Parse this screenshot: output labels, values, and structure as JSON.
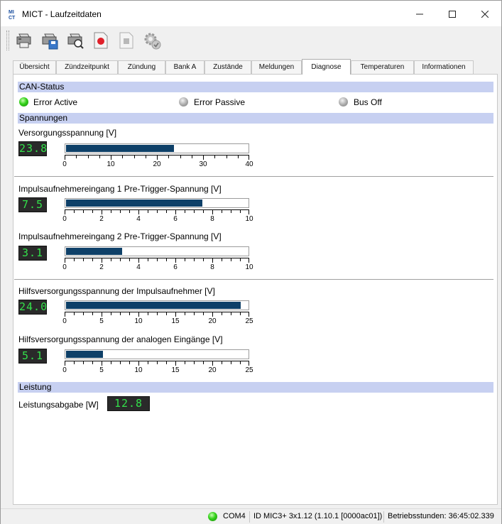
{
  "window": {
    "title": "MICT - Laufzeitdaten"
  },
  "toolbar": {
    "buttons": [
      "printer-icon",
      "save-printer-icon",
      "search-printer-icon",
      "record-icon",
      "stop-icon",
      "settings-check-icon"
    ]
  },
  "tabs": [
    "Übersicht",
    "Zündzeitpunkt",
    "Zündung",
    "Bank A",
    "Zustände",
    "Meldungen",
    "Diagnose",
    "Temperaturen",
    "Informationen"
  ],
  "active_tab": "Diagnose",
  "can_status": {
    "header": "CAN-Status",
    "items": [
      {
        "label": "Error Active",
        "state": "green"
      },
      {
        "label": "Error Passive",
        "state": "grey"
      },
      {
        "label": "Bus Off",
        "state": "grey"
      }
    ]
  },
  "spannungen": {
    "header": "Spannungen",
    "gauges": [
      {
        "label": "Versorgungsspannung [V]",
        "display": "23.8",
        "value": 23.8,
        "max": 40,
        "ticks": [
          "0",
          "10",
          "20",
          "30",
          "40"
        ]
      },
      {
        "label": "Impulsaufnehmereingang 1 Pre-Trigger-Spannung [V]",
        "display": "7.5",
        "value": 7.5,
        "max": 10,
        "ticks": [
          "0",
          "2",
          "4",
          "6",
          "8",
          "10"
        ]
      },
      {
        "label": "Impulsaufnehmereingang 2 Pre-Trigger-Spannung [V]",
        "display": "3.1",
        "value": 3.1,
        "max": 10,
        "ticks": [
          "0",
          "2",
          "4",
          "6",
          "8",
          "10"
        ]
      },
      {
        "label": "Hilfsversorgungsspannung der Impulsaufnehmer [V]",
        "display": "24.0",
        "value": 24.0,
        "max": 25,
        "ticks": [
          "0",
          "5",
          "10",
          "15",
          "20",
          "25"
        ]
      },
      {
        "label": "Hilfsversorgungsspannung der analogen Eingänge [V]",
        "display": "5.1",
        "value": 5.1,
        "max": 25,
        "ticks": [
          "0",
          "5",
          "10",
          "15",
          "20",
          "25"
        ]
      }
    ]
  },
  "leistung": {
    "header": "Leistung",
    "label": "Leistungsabgabe [W]",
    "display": "12.8"
  },
  "statusbar": {
    "port": "COM4",
    "device": "ID MIC3+ 3x1.12 (1.10.1 [0000ac01])",
    "hours": "Betriebsstunden: 36:45:02.339"
  },
  "colors": {
    "bar_fill": "#0e4068",
    "section_header": "#c7d0f1",
    "lcd_text": "#33e04a",
    "led_green": "#33d11a"
  }
}
